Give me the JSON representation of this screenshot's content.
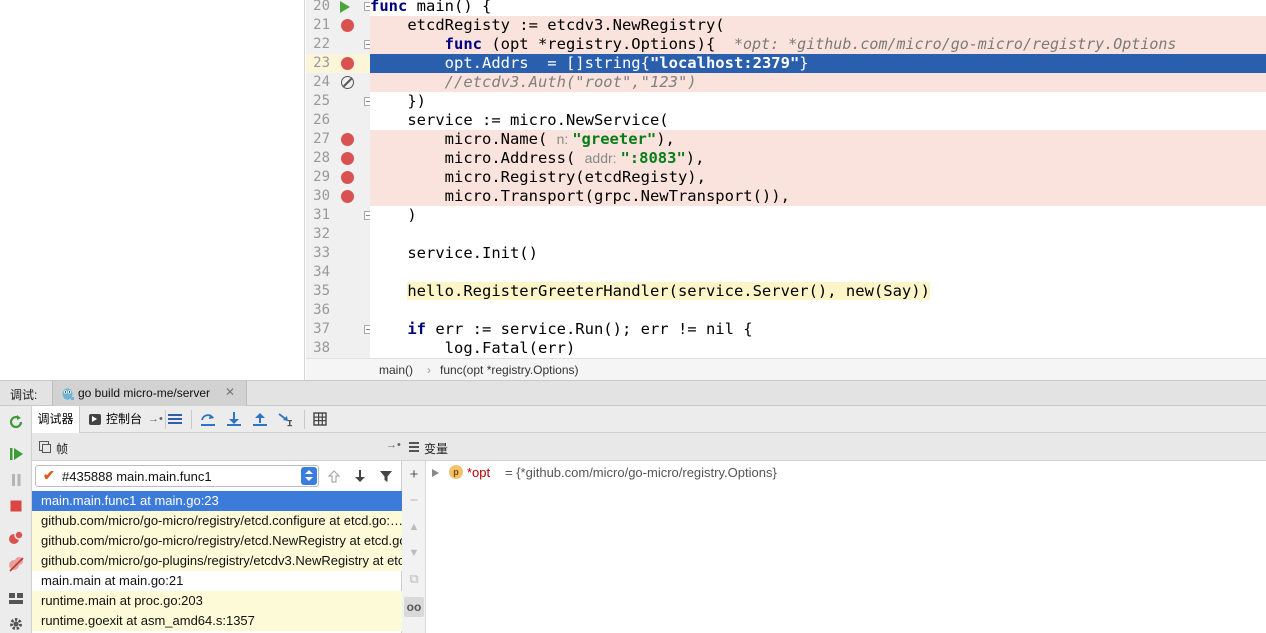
{
  "editor": {
    "lines": [
      {
        "num": "20"
      },
      {
        "num": "21"
      },
      {
        "num": "22"
      },
      {
        "num": "23"
      },
      {
        "num": "24"
      },
      {
        "num": "25"
      },
      {
        "num": "26"
      },
      {
        "num": "27"
      },
      {
        "num": "28"
      },
      {
        "num": "29"
      },
      {
        "num": "30"
      },
      {
        "num": "31"
      },
      {
        "num": "32"
      },
      {
        "num": "33"
      },
      {
        "num": "34"
      },
      {
        "num": "35"
      },
      {
        "num": "36"
      },
      {
        "num": "37"
      },
      {
        "num": "38"
      }
    ],
    "code": {
      "l20_kw": "func",
      "l20_rest": " main() {",
      "l21": "    etcdRegisty := etcdv3.NewRegistry(",
      "l22_indent": "        ",
      "l22_kw": "func",
      "l22_rest": " (opt *registry.Options){  ",
      "l22_inline": "*opt: *github.com/micro/go-micro/registry.Options",
      "l23_pre": "        opt.Addrs  = []string{",
      "l23_str": "\"localhost:2379\"",
      "l23_post": "}",
      "l24_indent": "        ",
      "l24_cmt": "//etcdv3.Auth(\"root\",\"123\")",
      "l25": "    })",
      "l26": "    service := micro.NewService(",
      "l27_pre": "        micro.Name( ",
      "l27_hint": "n: ",
      "l27_str": "\"greeter\"",
      "l27_post": "),",
      "l28_pre": "        micro.Address( ",
      "l28_hint": "addr: ",
      "l28_str": "\":8083\"",
      "l28_post": "),",
      "l29": "        micro.Registry(etcdRegisty),",
      "l30": "        micro.Transport(grpc.NewTransport()),",
      "l31": "    )",
      "l32": "",
      "l33": "    service.Init()",
      "l34": "",
      "l35_indent": "    ",
      "l35_hl": "hello.RegisterGreeterHandler(service.Server(), new(Say))",
      "l36": "",
      "l37_indent": "    ",
      "l37_kw": "if",
      "l37_rest": " err := service.Run(); err != nil {",
      "l38": "        log.Fatal(err)"
    },
    "breadcrumb": [
      "main()",
      "func(opt *registry.Options)"
    ]
  },
  "debug": {
    "window_label": "调试:",
    "run_tab": "go build micro-me/server",
    "tabs": {
      "debugger": "调试器",
      "console": "控制台"
    },
    "frames_title": "帧",
    "variables_title": "变量",
    "thread": "#435888 main.main.func1",
    "frames": [
      {
        "label": "main.main.func1 at main.go:23",
        "style": "sel"
      },
      {
        "label": "github.com/micro/go-micro/registry/etcd.configure at etcd.go:…",
        "style": "lib"
      },
      {
        "label": "github.com/micro/go-micro/registry/etcd.NewRegistry at etcd.go:…",
        "style": "lib"
      },
      {
        "label": "github.com/micro/go-plugins/registry/etcdv3.NewRegistry at etcd…",
        "style": "lib"
      },
      {
        "label": "main.main at main.go:21",
        "style": "plain"
      },
      {
        "label": "runtime.main at proc.go:203",
        "style": "lib"
      },
      {
        "label": "runtime.goexit at asm_amd64.s:1357",
        "style": "lib"
      }
    ],
    "variable": {
      "badge": "p",
      "name": "*opt",
      "value": "= {*github.com/micro/go-micro/registry.Options}"
    }
  },
  "colors": {
    "breakpoint": "#d9524f",
    "execution_line": "#2a5fae",
    "breakpoint_line_bg": "#fae3dd",
    "selected_frame": "#3c7bd9",
    "library_frame_bg": "#fdfad8",
    "keyword": "#000080",
    "string": "#067d17"
  }
}
